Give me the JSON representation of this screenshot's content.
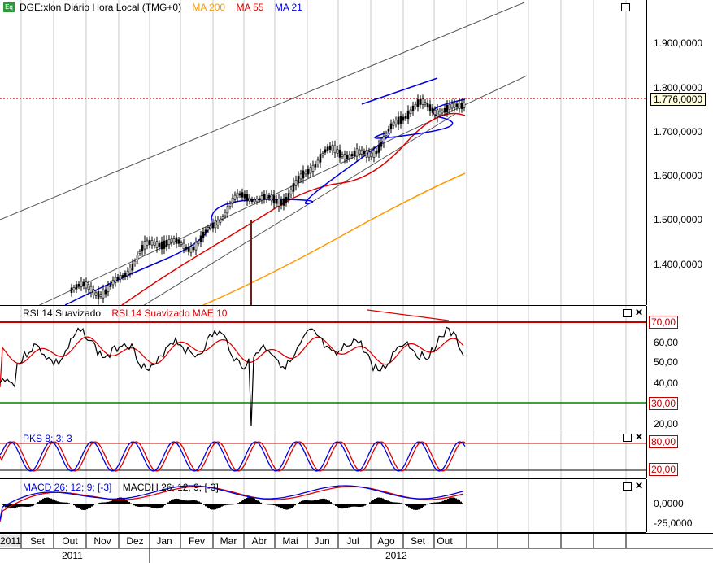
{
  "main": {
    "title": "DGE:xlon Diário Hora Local (TMG+0)",
    "ma200": "MA 200",
    "ma55": "MA 55",
    "ma21": "MA 21",
    "price_label": "1.776,0000",
    "yticks": [
      "1.900,0000",
      "1.800,0000",
      "1.700,0000",
      "1.600,0000",
      "1.500,0000",
      "1.400,0000"
    ]
  },
  "rsi": {
    "label": "RSI 14 Suavizado",
    "mae_label": "RSI 14 Suavizado MAE 10",
    "upper_label": "70,00",
    "lower_label": "30,00",
    "yticks": [
      "60,00",
      "50,00",
      "40,00",
      "20,00"
    ]
  },
  "pks": {
    "label": "PKS 8; 3; 3",
    "upper_label": "80,00",
    "lower_label": "20,00"
  },
  "macd": {
    "label": "MACD 26; 12; 9; [-3]",
    "hist_label": "MACDH 26; 12; 9; [-3]",
    "yticks": [
      "0,0000",
      "-25,0000"
    ]
  },
  "xaxis": {
    "months": [
      "2011",
      "Set",
      "Out",
      "Nov",
      "Dez",
      "Jan",
      "Fev",
      "Mar",
      "Abr",
      "Mai",
      "Jun",
      "Jul",
      "Ago",
      "Set",
      "Out"
    ],
    "years": [
      "2011",
      "2012"
    ]
  },
  "colors": {
    "ma200": "#ff9900",
    "ma55": "#e00000",
    "ma21": "#0000e0",
    "rsi": "#000000",
    "rsi_mae": "#e00000",
    "upper_band": "#c00000",
    "lower_band": "#008000"
  }
}
